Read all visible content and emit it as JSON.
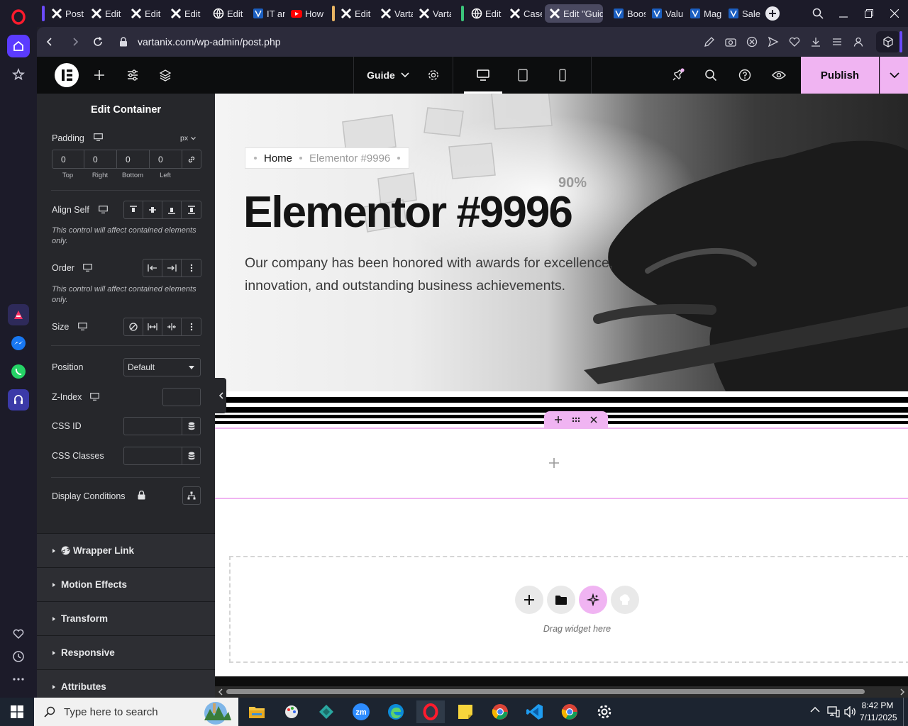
{
  "browser": {
    "tabs": [
      {
        "label": "Posts",
        "icon": "wp-x-icon"
      },
      {
        "label": "Edit",
        "icon": "wp-x-icon"
      },
      {
        "label": "Edit",
        "icon": "wp-x-icon"
      },
      {
        "label": "Edit",
        "icon": "wp-x-icon"
      },
      {
        "label": "Edit",
        "icon": "globe-icon"
      },
      {
        "label": "IT an",
        "icon": "blue-square-icon"
      },
      {
        "label": "How",
        "icon": "youtube-icon"
      },
      {
        "label": "Edit",
        "icon": "wp-x-icon"
      },
      {
        "label": "Varta",
        "icon": "wp-x-icon"
      },
      {
        "label": "Varta",
        "icon": "wp-x-icon"
      },
      {
        "label": "Edit",
        "icon": "globe-icon"
      },
      {
        "label": "Case",
        "icon": "wp-x-icon"
      },
      {
        "label": "Edit \"Guid",
        "icon": "wp-x-icon",
        "active": true
      },
      {
        "label": "Boos",
        "icon": "blue-square-icon"
      },
      {
        "label": "Valu",
        "icon": "blue-square-icon"
      },
      {
        "label": "Mag",
        "icon": "blue-square-icon"
      },
      {
        "label": "Sales",
        "icon": "blue-square-icon"
      }
    ],
    "url": "vartanix.com/wp-admin/post.php"
  },
  "editor": {
    "page_name": "Guide",
    "publish_label": "Publish",
    "accent": "#f0b4f2"
  },
  "panel": {
    "title": "Edit Container",
    "padding": {
      "label": "Padding",
      "unit": "px",
      "values": [
        "0",
        "0",
        "0",
        "0"
      ],
      "sides": [
        "Top",
        "Right",
        "Bottom",
        "Left"
      ]
    },
    "align_self": {
      "label": "Align Self"
    },
    "align_note": "This control will affect contained elements only.",
    "order": {
      "label": "Order"
    },
    "order_note": "This control will affect contained elements only.",
    "size": {
      "label": "Size"
    },
    "position": {
      "label": "Position",
      "value": "Default"
    },
    "z_index": {
      "label": "Z-Index",
      "value": ""
    },
    "css_id": {
      "label": "CSS ID",
      "value": ""
    },
    "css_classes": {
      "label": "CSS Classes",
      "value": ""
    },
    "display_conditions": {
      "label": "Display Conditions"
    },
    "sections": [
      "Wrapper Link",
      "Motion Effects",
      "Transform",
      "Responsive",
      "Attributes"
    ]
  },
  "canvas": {
    "breadcrumb": {
      "home": "Home",
      "current": "Elementor #9996"
    },
    "hero_title": "Elementor #9996",
    "hero_text": "Our company has been honored with awards for excellence, innovation, and outstanding business achievements.",
    "overlay_percent": "90%",
    "drag_hint": "Drag widget here"
  },
  "taskbar": {
    "search_placeholder": "Type here to search",
    "time": "8:42 PM",
    "date": "7/11/2025"
  }
}
